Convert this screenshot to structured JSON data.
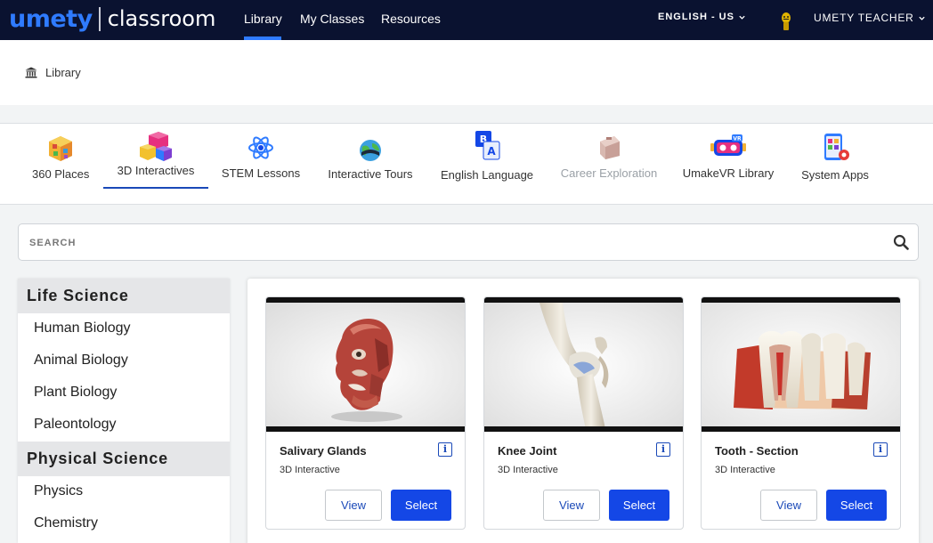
{
  "brand": {
    "logo_left": "umety",
    "logo_right": "classroom"
  },
  "topnav": {
    "links": [
      {
        "label": "Library"
      },
      {
        "label": "My Classes"
      },
      {
        "label": "Resources"
      }
    ],
    "language": "ENGLISH - US",
    "user": "UMETY TEACHER"
  },
  "breadcrumb": {
    "label": "Library",
    "icon": "library-icon"
  },
  "categories": [
    {
      "label": "360 Places",
      "icon": "cube-360-icon"
    },
    {
      "label": "3D Interactives",
      "icon": "blocks-3d-icon",
      "active": true
    },
    {
      "label": "STEM Lessons",
      "icon": "atom-icon"
    },
    {
      "label": "Interactive Tours",
      "icon": "globe-tour-icon"
    },
    {
      "label": "English Language",
      "icon": "language-icon"
    },
    {
      "label": "Career Exploration",
      "icon": "briefcase-icon",
      "disabled": true
    },
    {
      "label": "UmakeVR Library",
      "icon": "vr-headset-icon"
    },
    {
      "label": "System Apps",
      "icon": "apps-icon"
    }
  ],
  "search": {
    "placeholder": "SEARCH"
  },
  "sidebar": {
    "sections": [
      {
        "heading": "Life Science",
        "items": [
          "Human Biology",
          "Animal Biology",
          "Plant Biology",
          "Paleontology"
        ]
      },
      {
        "heading": "Physical Science",
        "items": [
          "Physics",
          "Chemistry"
        ]
      }
    ]
  },
  "cards": [
    {
      "title": "Salivary Glands",
      "type": "3D Interactive",
      "view": "View",
      "select": "Select",
      "thumb": "head-muscles-thumbnail"
    },
    {
      "title": "Knee Joint",
      "type": "3D Interactive",
      "view": "View",
      "select": "Select",
      "thumb": "knee-joint-thumbnail"
    },
    {
      "title": "Tooth - Section",
      "type": "3D Interactive",
      "view": "View",
      "select": "Select",
      "thumb": "tooth-section-thumbnail"
    }
  ],
  "colors": {
    "nav_bg": "#0a1230",
    "accent": "#1447e6",
    "brand_blue": "#2f7bff"
  }
}
